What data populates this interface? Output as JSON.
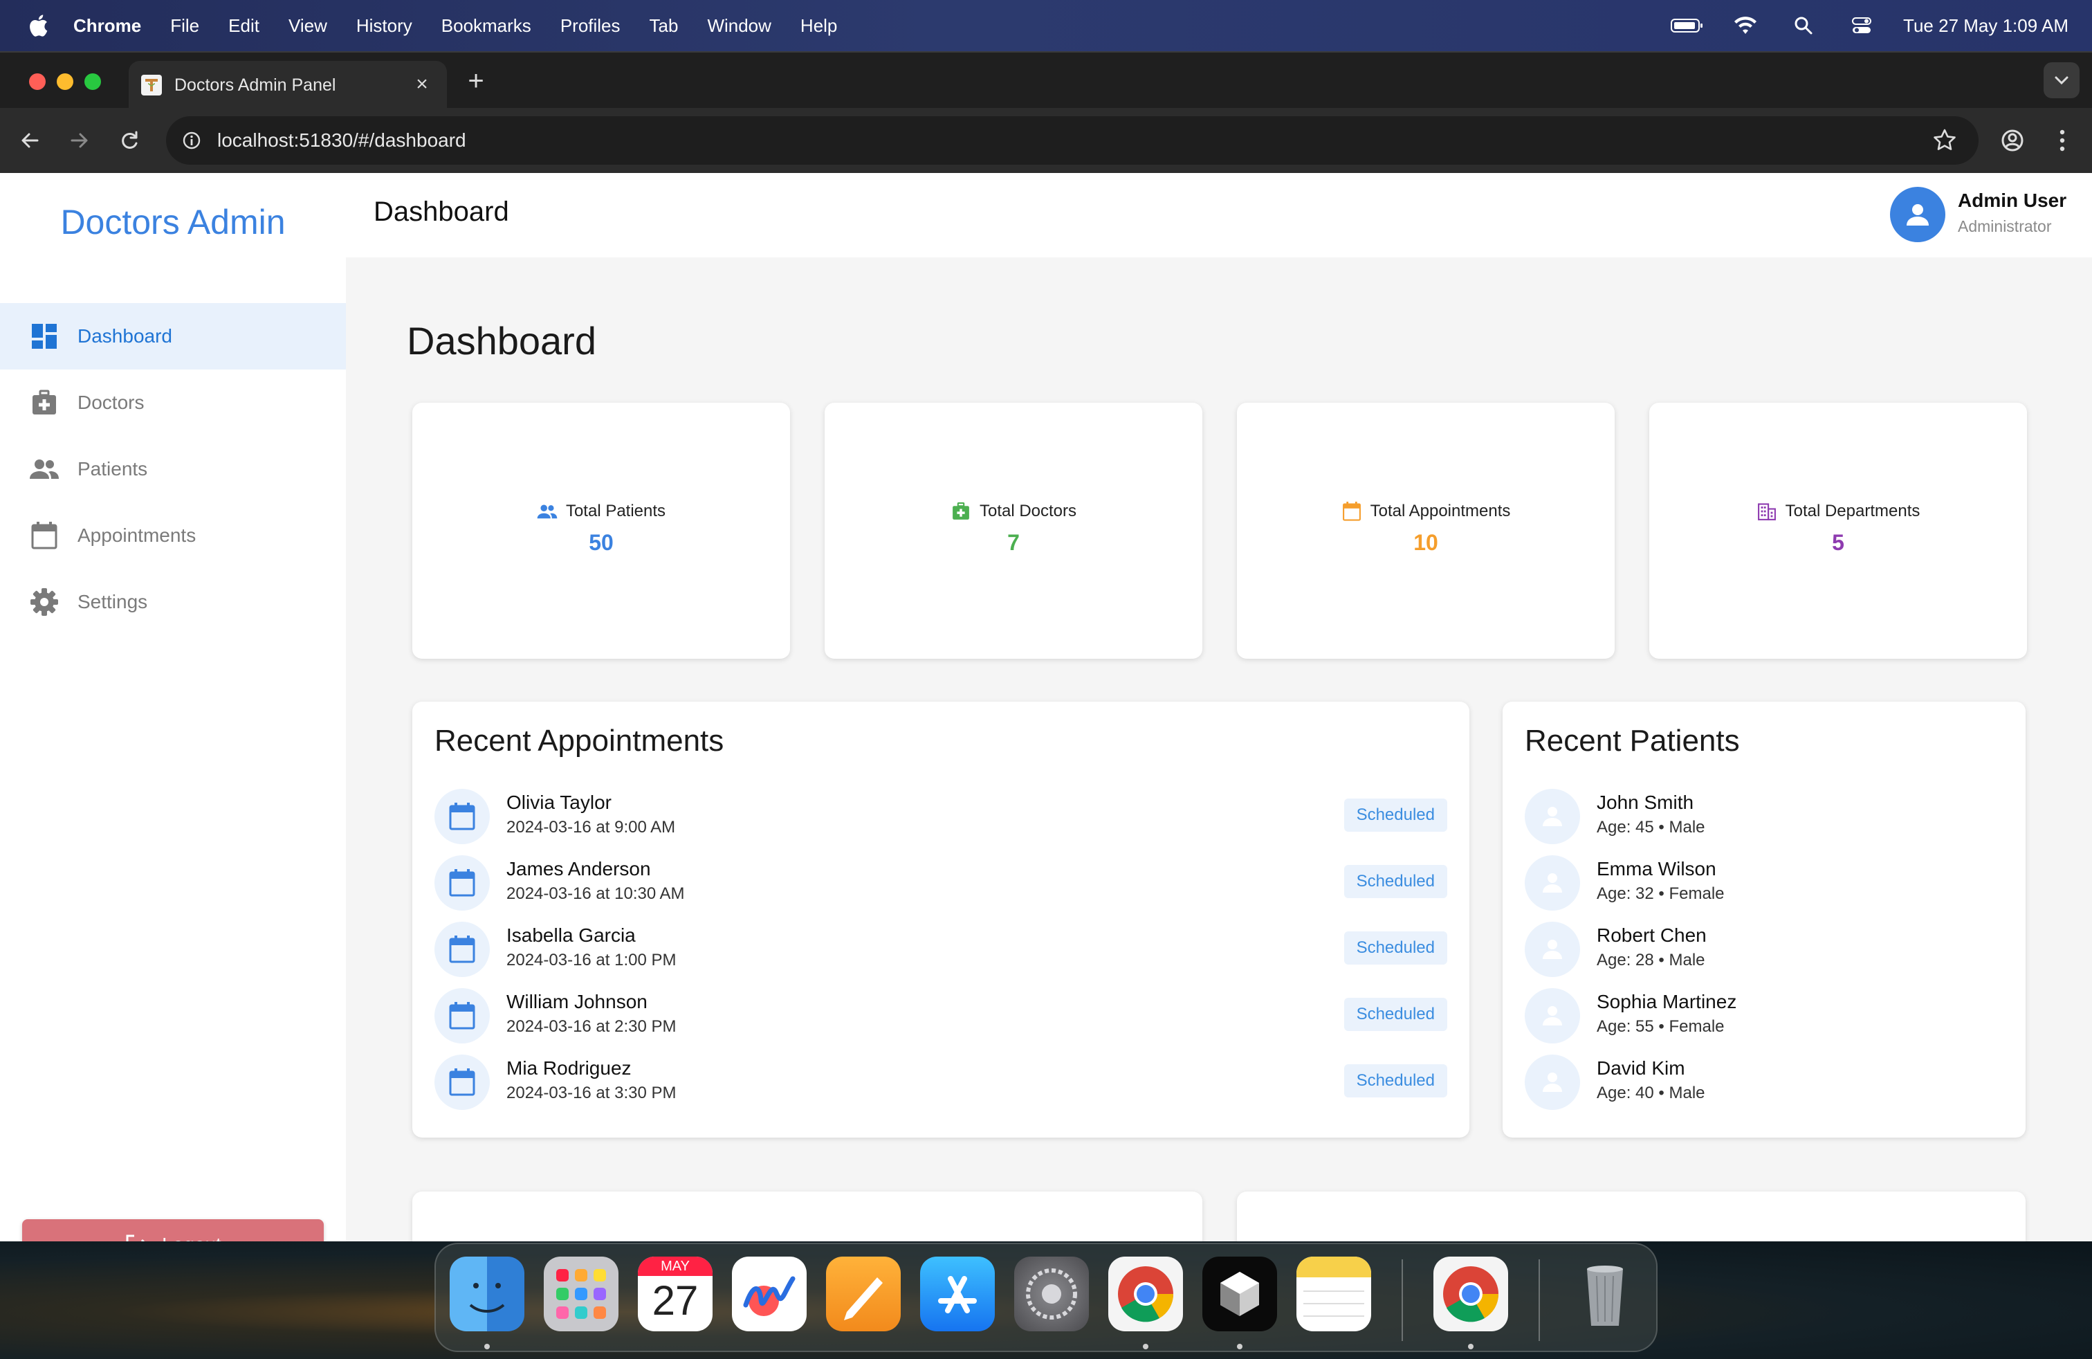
{
  "menubar": {
    "app": "Chrome",
    "items": [
      "File",
      "Edit",
      "View",
      "History",
      "Bookmarks",
      "Profiles",
      "Tab",
      "Window",
      "Help"
    ],
    "clock": "Tue 27 May  1:09 AM"
  },
  "browser": {
    "tab_title": "Doctors Admin Panel",
    "url": "localhost:51830/#/dashboard"
  },
  "sidebar": {
    "brand": "Doctors Admin",
    "items": [
      {
        "label": "Dashboard",
        "icon": "dashboard-icon",
        "active": true
      },
      {
        "label": "Doctors",
        "icon": "medical-bag-icon",
        "active": false
      },
      {
        "label": "Patients",
        "icon": "people-icon",
        "active": false
      },
      {
        "label": "Appointments",
        "icon": "calendar-icon",
        "active": false
      },
      {
        "label": "Settings",
        "icon": "gear-icon",
        "active": false
      }
    ],
    "logout_label": "Logout"
  },
  "header": {
    "title": "Dashboard",
    "user_name": "Admin User",
    "user_role": "Administrator"
  },
  "main": {
    "heading": "Dashboard",
    "stats": [
      {
        "label": "Total Patients",
        "value": "50",
        "color": "#3b82e0",
        "icon": "people-icon"
      },
      {
        "label": "Total Doctors",
        "value": "7",
        "color": "#4caf50",
        "icon": "medical-bag-icon"
      },
      {
        "label": "Total Appointments",
        "value": "10",
        "color": "#f59e2c",
        "icon": "calendar-icon"
      },
      {
        "label": "Total Departments",
        "value": "5",
        "color": "#8e3bb0",
        "icon": "building-icon"
      }
    ],
    "recent_appointments": {
      "title": "Recent Appointments",
      "items": [
        {
          "name": "Olivia Taylor",
          "when": "2024-03-16 at 9:00 AM",
          "status": "Scheduled"
        },
        {
          "name": "James Anderson",
          "when": "2024-03-16 at 10:30 AM",
          "status": "Scheduled"
        },
        {
          "name": "Isabella Garcia",
          "when": "2024-03-16 at 1:00 PM",
          "status": "Scheduled"
        },
        {
          "name": "William Johnson",
          "when": "2024-03-16 at 2:30 PM",
          "status": "Scheduled"
        },
        {
          "name": "Mia Rodriguez",
          "when": "2024-03-16 at 3:30 PM",
          "status": "Scheduled"
        }
      ]
    },
    "recent_patients": {
      "title": "Recent Patients",
      "items": [
        {
          "name": "John Smith",
          "details": "Age: 45 • Male"
        },
        {
          "name": "Emma Wilson",
          "details": "Age: 32 • Female"
        },
        {
          "name": "Robert Chen",
          "details": "Age: 28 • Male"
        },
        {
          "name": "Sophia Martinez",
          "details": "Age: 55 • Female"
        },
        {
          "name": "David Kim",
          "details": "Age: 40 • Male"
        }
      ]
    }
  },
  "dock": {
    "calendar_month": "MAY",
    "calendar_day": "27",
    "apps": [
      "finder-icon",
      "launchpad-icon",
      "calendar-icon",
      "freeform-icon",
      "pages-icon",
      "app-store-icon",
      "system-settings-icon",
      "chrome-icon",
      "cube-app-icon",
      "notes-icon",
      "chrome-icon",
      "trash-icon"
    ]
  },
  "colors": {
    "accent": "#3b82e0",
    "logout": "#d9727a",
    "badge_text": "#3b8de0",
    "badge_bg": "#eaf2fc"
  }
}
